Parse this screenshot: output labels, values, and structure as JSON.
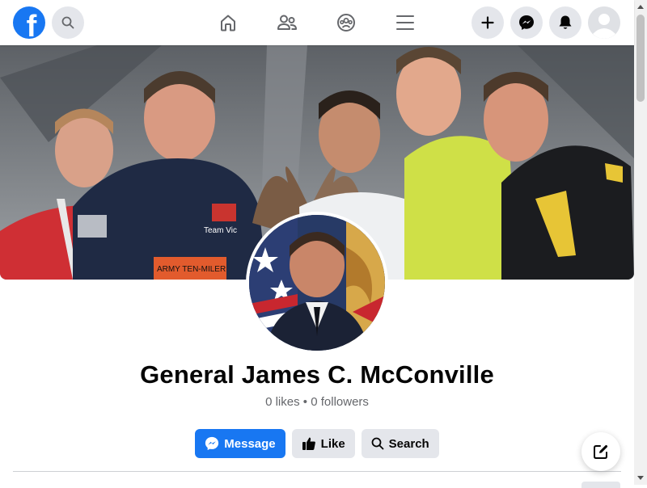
{
  "nav": {
    "logo_letter": "f",
    "icons": {
      "search": "search-icon",
      "home": "home-icon",
      "friends": "friends-icon",
      "groups": "groups-icon",
      "menu": "menu-icon",
      "create": "plus-icon",
      "messenger": "messenger-icon",
      "notifications": "bell-icon",
      "account": "avatar-icon"
    }
  },
  "profile": {
    "name": "General James C. McConville",
    "likes": "0 likes",
    "separator": "•",
    "followers": "0 followers",
    "cover_banner_text": "Team Vic",
    "cover_bib_text": "ARMY TEN-MILER"
  },
  "actions": {
    "message_label": "Message",
    "like_label": "Like",
    "search_label": "Search"
  },
  "colors": {
    "brand": "#1877f2",
    "secondary_button": "#e4e6eb",
    "muted_text": "#65676b"
  }
}
